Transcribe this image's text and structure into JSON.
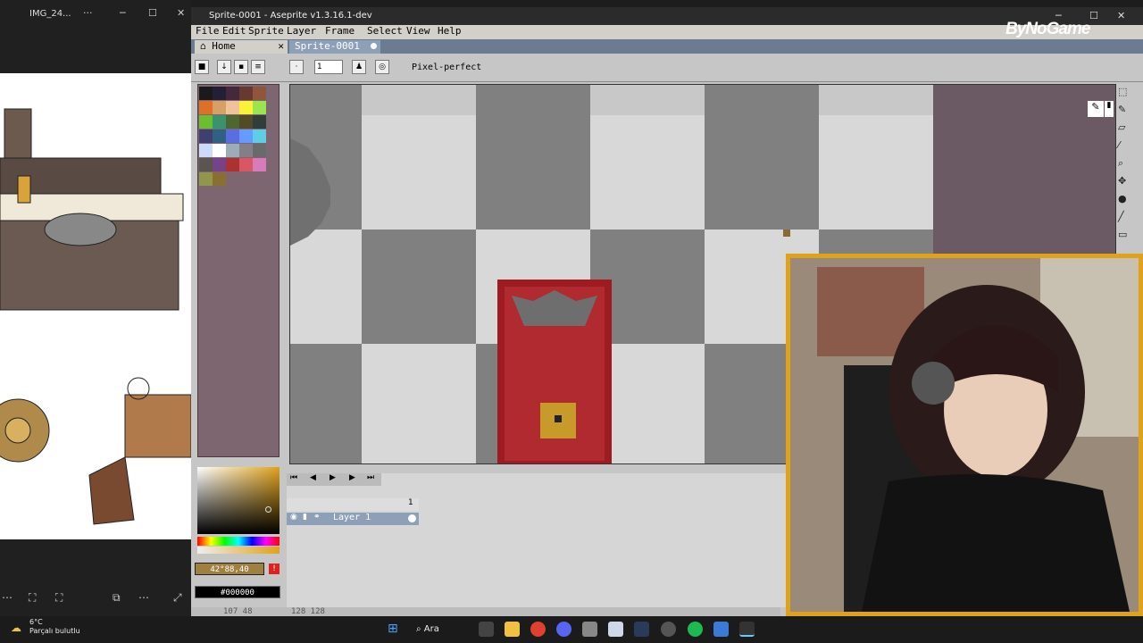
{
  "viewer": {
    "title": "IMG_24...",
    "more": "···",
    "minimize": "─",
    "maximize": "☐",
    "close": "✕",
    "bottom_icons": [
      "⋯",
      "⛶",
      "⛶",
      "⧉",
      "⋯",
      "⤢"
    ]
  },
  "aseprite": {
    "window_title": "Sprite-0001 - Aseprite v1.3.16.1-dev",
    "minimize": "─",
    "maximize": "☐",
    "close": "✕",
    "menu": [
      "File",
      "Edit",
      "Sprite",
      "Layer",
      "Frame",
      "Select",
      "View",
      "Help"
    ],
    "tabs": [
      {
        "label": "Home"
      },
      {
        "label": "Sprite-0001"
      }
    ],
    "tab_close": "✕",
    "brush_size": "1",
    "pixel_perfect": "Pixel-perfect",
    "color_value": "42°88,40",
    "hex_value": "#000000",
    "warning_icon": "!",
    "layer_name": "Layer 1",
    "frame_number": "1",
    "status_coords": "107 48",
    "status_size": "128 128"
  },
  "logo": "ByNoGame",
  "taskbar": {
    "temp": "6°C",
    "weather": "Parçalı bulutlu",
    "search": "Ara"
  },
  "colors": {
    "accent_orange": "#e0a21a",
    "sprite_red": "#9e1b22",
    "canvas_right": "#6b5a63",
    "palette_bg": "#7d6670"
  }
}
